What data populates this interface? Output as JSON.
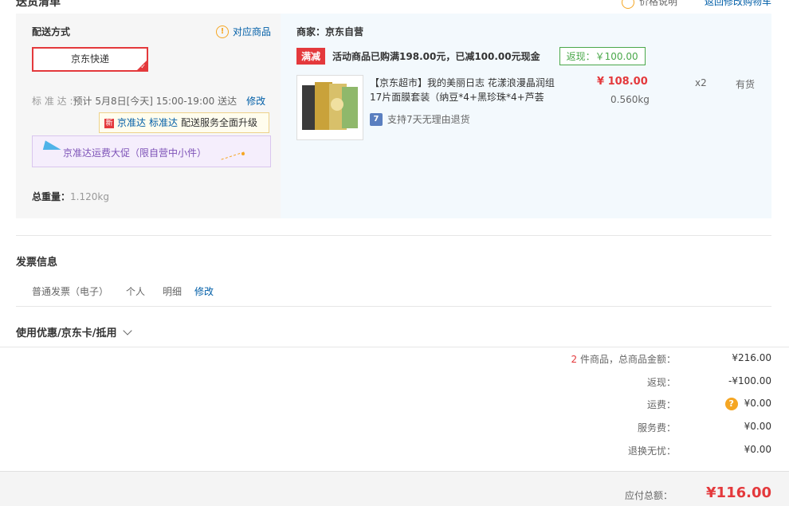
{
  "header_cut": {
    "left_text": "送货清单",
    "right_link1": "价格说明",
    "right_link2": "返回修改购物车"
  },
  "shipping": {
    "title": "配送方式",
    "corresponding_goods": "对应商品",
    "method": "京东快递",
    "standard_label": "标 准 达 :",
    "eta": "预计 5月8日[今天] 15:00-19:00 送达",
    "edit": "修改",
    "tip": {
      "new_badge": "新",
      "a": "京准达",
      "b": "标准达",
      "c": "配送服务全面升级"
    },
    "promo": "京准达运费大促（限自营中小件）",
    "total_weight_label": "总重量：",
    "total_weight_value": "1.120kg"
  },
  "merchant": {
    "label": "商家：京东自营",
    "manjian_tag": "满减",
    "manjian_text": "活动商品已购满198.00元，已减100.00元现金",
    "fanxian": "返现：￥100.00"
  },
  "item": {
    "name": "【京东超市】我的美丽日志 花漾浪漫晶润组17片面膜套装（纳豆*4+黑珍珠*4+芦荟",
    "return_policy": "支持7天无理由退货",
    "seven_icon": "7",
    "price": "¥ 108.00",
    "weight": "0.560kg",
    "qty": "x2",
    "stock": "有货"
  },
  "invoice": {
    "title": "发票信息",
    "type": "普通发票（电子）",
    "person": "个人",
    "detail": "明细",
    "edit": "修改"
  },
  "coupon": {
    "title": "使用优惠/京东卡/抵用"
  },
  "summary": {
    "count": "2",
    "count_label": "件商品，总商品金额：",
    "goods_total": "¥216.00",
    "fanxian_label": "返现：",
    "fanxian_value": "-¥100.00",
    "freight_label": "运费：",
    "freight_value": "¥0.00",
    "service_label": "服务费：",
    "service_value": "¥0.00",
    "return_label": "退换无忧：",
    "return_value": "¥0.00",
    "payable_label": "应付总额：",
    "payable_value": "¥116.00"
  },
  "colors": {
    "brand_red": "#e4393c",
    "link_blue": "#005ea7",
    "green": "#4aa84a"
  }
}
